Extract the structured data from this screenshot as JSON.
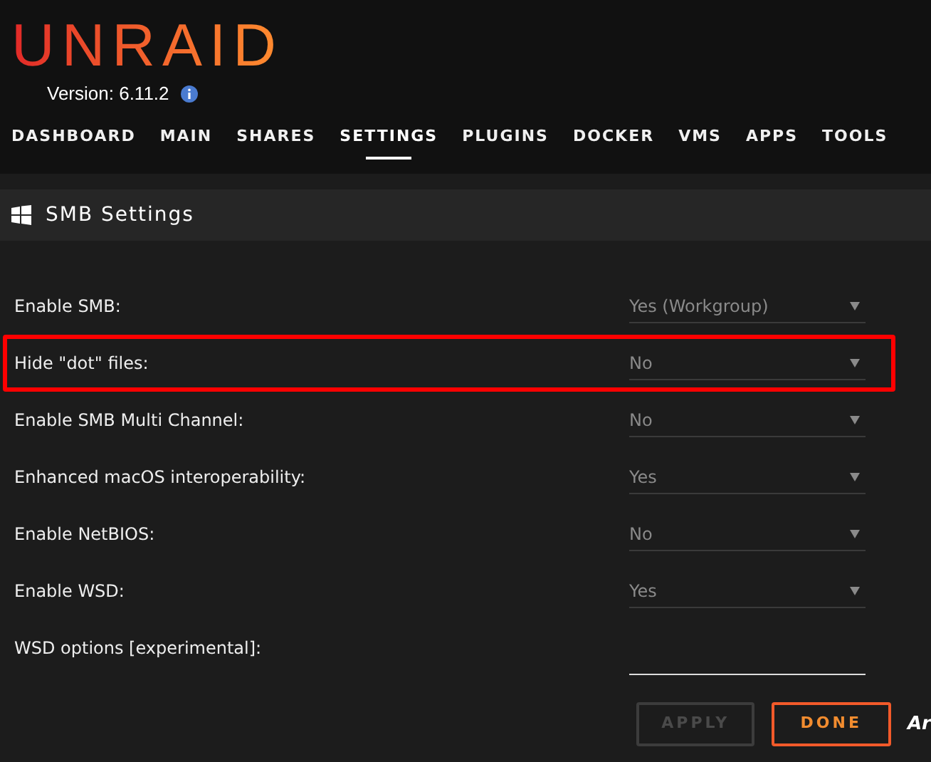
{
  "logo": "UNRAID",
  "version": "Version: 6.11.2",
  "nav": [
    {
      "label": "DASHBOARD",
      "selected": false
    },
    {
      "label": "MAIN",
      "selected": false
    },
    {
      "label": "SHARES",
      "selected": false
    },
    {
      "label": "SETTINGS",
      "selected": true
    },
    {
      "label": "PLUGINS",
      "selected": false
    },
    {
      "label": "DOCKER",
      "selected": false
    },
    {
      "label": "VMS",
      "selected": false
    },
    {
      "label": "APPS",
      "selected": false
    },
    {
      "label": "TOOLS",
      "selected": false
    }
  ],
  "panel_title": "SMB Settings",
  "settings": [
    {
      "kind": "select",
      "label": "Enable SMB:",
      "value": "Yes (Workgroup)",
      "highlighted": false
    },
    {
      "kind": "select",
      "label": "Hide \"dot\" files:",
      "value": "No",
      "highlighted": true
    },
    {
      "kind": "select",
      "label": "Enable SMB Multi Channel:",
      "value": "No",
      "highlighted": false
    },
    {
      "kind": "select",
      "label": "Enhanced macOS interoperability:",
      "value": "Yes",
      "highlighted": false
    },
    {
      "kind": "select",
      "label": "Enable NetBIOS:",
      "value": "No",
      "highlighted": false
    },
    {
      "kind": "select",
      "label": "Enable WSD:",
      "value": "Yes",
      "highlighted": false
    },
    {
      "kind": "text",
      "label": "WSD options [experimental]:",
      "highlighted": false
    }
  ],
  "buttons": [
    {
      "label": "APPLY",
      "disabled": true
    },
    {
      "label": "DONE",
      "disabled": false
    }
  ],
  "trailing_text": "Ar"
}
